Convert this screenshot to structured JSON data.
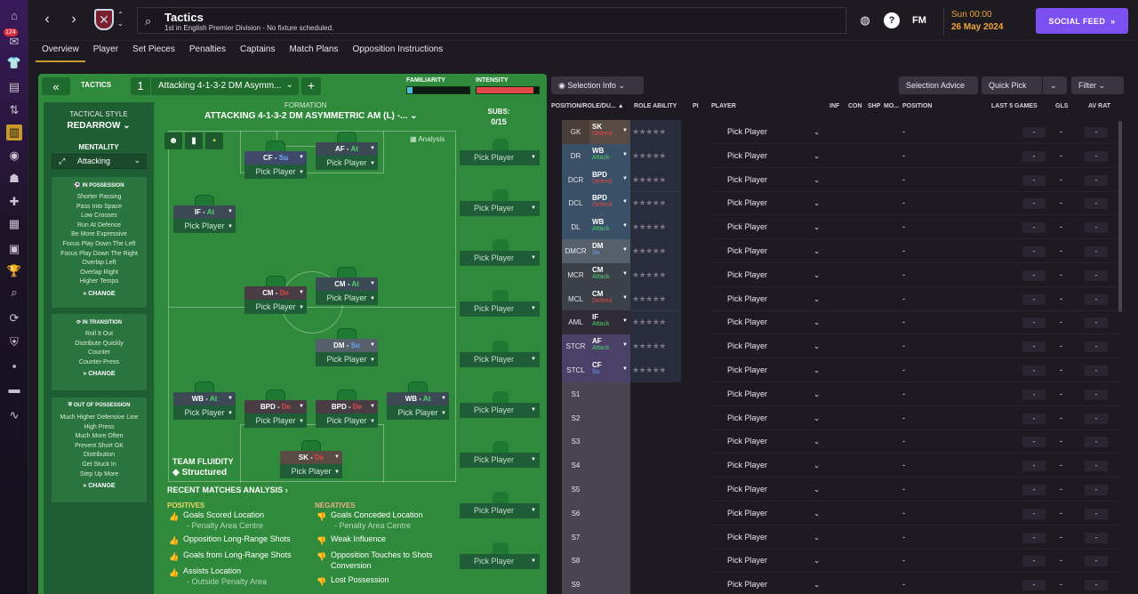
{
  "sidebar": {
    "badge": "124",
    "icons": [
      "home-icon",
      "inbox-icon",
      "squad-icon",
      "document-icon",
      "transfer-icon",
      "tactics-icon",
      "data-icon",
      "staff-icon",
      "medical-icon",
      "schedule-icon",
      "competitions-icon",
      "scouting-icon",
      "swap-icon",
      "club-vision-icon",
      "finance-icon",
      "team-report-icon",
      "news-icon"
    ]
  },
  "header": {
    "title": "Tactics",
    "subtitle": "1st in English Premier Division - No fixture scheduled.",
    "date_time": "Sun 00:00",
    "date_day": "26 May 2024",
    "fm_label": "FM",
    "social_feed": "SOCIAL FEED"
  },
  "tabs": [
    "Overview",
    "Player",
    "Set Pieces",
    "Penalties",
    "Captains",
    "Match Plans",
    "Opposition Instructions"
  ],
  "tactics": {
    "label": "TACTICS",
    "slot_number": "1",
    "selected_tactic": "Attacking 4-1-3-2 DM Asymm...",
    "familiarity_label": "FAMILIARITY",
    "intensity_label": "INTENSITY",
    "familiarity_level": 0.08,
    "intensity_level": 0.92,
    "formation_label": "FORMATION",
    "formation_name": "ATTACKING 4-1-3-2 DM ASYMMETRIC AM (L) -...",
    "analysis_label": "Analysis",
    "subs_label": "SUBS:",
    "subs_count": "0/15",
    "fluidity_label": "TEAM FLUIDITY",
    "fluidity_value": "Structured"
  },
  "style": {
    "title": "TACTICAL STYLE",
    "value": "REDARROW",
    "mentality_label": "MENTALITY",
    "mentality_value": "Attacking",
    "in_possession": {
      "title": "IN POSSESSION",
      "items": [
        "Shorter Passing",
        "Pass Into Space",
        "Low Crosses",
        "Run At Defence",
        "Be More Expressive",
        "Focus Play Down The Left",
        "Focus Play Down The Right",
        "Overlap Left",
        "Overlap Right",
        "Higher Tempo"
      ],
      "change": "CHANGE"
    },
    "in_transition": {
      "title": "IN TRANSITION",
      "items": [
        "Roll It Out",
        "Distribute Quickly",
        "Counter",
        "Counter-Press"
      ],
      "change": "CHANGE"
    },
    "out_of_possession": {
      "title": "OUT OF POSSESSION",
      "items": [
        "Much Higher Defensive Line",
        "High Press",
        "Much More Often",
        "Prevent Short GK",
        "Distribution",
        "Get Stuck In",
        "Step Up More"
      ],
      "change": "CHANGE"
    }
  },
  "pitch_players": [
    {
      "pos": "CF",
      "role": "CF",
      "duty": "Su",
      "pick": "Pick Player"
    },
    {
      "pos": "AF",
      "role": "AF",
      "duty": "At",
      "pick": "Pick Player"
    },
    {
      "pos": "IF",
      "role": "IF",
      "duty": "At",
      "pick": "Pick Player"
    },
    {
      "pos": "CML",
      "role": "CM",
      "duty": "De",
      "pick": "Pick Player"
    },
    {
      "pos": "CMR",
      "role": "CM",
      "duty": "At",
      "pick": "Pick Player"
    },
    {
      "pos": "DM",
      "role": "DM",
      "duty": "Su",
      "pick": "Pick Player"
    },
    {
      "pos": "WBL",
      "role": "WB",
      "duty": "At",
      "pick": "Pick Player"
    },
    {
      "pos": "BPDL",
      "role": "BPD",
      "duty": "De",
      "pick": "Pick Player"
    },
    {
      "pos": "BPDR",
      "role": "BPD",
      "duty": "De",
      "pick": "Pick Player"
    },
    {
      "pos": "WBR",
      "role": "WB",
      "duty": "At",
      "pick": "Pick Player"
    },
    {
      "pos": "GK",
      "role": "SK",
      "duty": "De",
      "pick": "Pick Player"
    }
  ],
  "subs_pick": "Pick Player",
  "recent": {
    "title": "RECENT MATCHES ANALYSIS",
    "positives_label": "POSITIVES",
    "negatives_label": "NEGATIVES",
    "positives": [
      {
        "text": "Goals Scored Location",
        "sub": "- Penalty Area Centre"
      },
      {
        "text": "Opposition Long-Range Shots",
        "sub": ""
      },
      {
        "text": "Goals from Long-Range Shots",
        "sub": ""
      },
      {
        "text": "Assists Location",
        "sub": "- Outside Penalty Area"
      }
    ],
    "negatives": [
      {
        "text": "Goals Conceded Location",
        "sub": "- Penalty Area Centre"
      },
      {
        "text": "Weak Influence",
        "sub": ""
      },
      {
        "text": "Opposition Touches to Shots",
        "sub": "Conversion"
      },
      {
        "text": "Lost Possession",
        "sub": ""
      }
    ]
  },
  "right_panel": {
    "selection_info": "Selection Info",
    "selection_advice": "Selection Advice",
    "quick_pick": "Quick Pick",
    "filter": "Filter",
    "columns": [
      "POSITION/ROLE/DU...",
      "ROLE ABILITY",
      "PI",
      "PLAYER",
      "INF",
      "CON",
      "SHP",
      "MO...",
      "POSITION",
      "LAST 5 GAMES",
      "GLS",
      "AV RAT"
    ],
    "rows": [
      {
        "pos": "GK",
        "role": "SK",
        "duty": "Defend",
        "pick": "Pick Player",
        "position": "-",
        "last5": "-",
        "gls": "-",
        "avrat": "-"
      },
      {
        "pos": "DR",
        "role": "WB",
        "duty": "Attack",
        "pick": "Pick Player",
        "position": "-",
        "last5": "-",
        "gls": "-",
        "avrat": "-"
      },
      {
        "pos": "DCR",
        "role": "BPD",
        "duty": "Defend",
        "pick": "Pick Player",
        "position": "-",
        "last5": "-",
        "gls": "-",
        "avrat": "-"
      },
      {
        "pos": "DCL",
        "role": "BPD",
        "duty": "Defend",
        "pick": "Pick Player",
        "position": "-",
        "last5": "-",
        "gls": "-",
        "avrat": "-"
      },
      {
        "pos": "DL",
        "role": "WB",
        "duty": "Attack",
        "pick": "Pick Player",
        "position": "-",
        "last5": "-",
        "gls": "-",
        "avrat": "-"
      },
      {
        "pos": "DMCR",
        "role": "DM",
        "duty": "Su",
        "pick": "Pick Player",
        "position": "-",
        "last5": "-",
        "gls": "-",
        "avrat": "-"
      },
      {
        "pos": "MCR",
        "role": "CM",
        "duty": "Attack",
        "pick": "Pick Player",
        "position": "-",
        "last5": "-",
        "gls": "-",
        "avrat": "-"
      },
      {
        "pos": "MCL",
        "role": "CM",
        "duty": "Defend",
        "pick": "Pick Player",
        "position": "-",
        "last5": "-",
        "gls": "-",
        "avrat": "-"
      },
      {
        "pos": "AML",
        "role": "IF",
        "duty": "Attack",
        "pick": "Pick Player",
        "position": "-",
        "last5": "-",
        "gls": "-",
        "avrat": "-"
      },
      {
        "pos": "STCR",
        "role": "AF",
        "duty": "Attack",
        "pick": "Pick Player",
        "position": "-",
        "last5": "-",
        "gls": "-",
        "avrat": "-"
      },
      {
        "pos": "STCL",
        "role": "CF",
        "duty": "Su",
        "pick": "Pick Player",
        "position": "-",
        "last5": "-",
        "gls": "-",
        "avrat": "-"
      },
      {
        "pos": "S1",
        "role": "",
        "duty": "",
        "pick": "Pick Player",
        "position": "-",
        "last5": "-",
        "gls": "-",
        "avrat": "-"
      },
      {
        "pos": "S2",
        "role": "",
        "duty": "",
        "pick": "Pick Player",
        "position": "-",
        "last5": "-",
        "gls": "-",
        "avrat": "-"
      },
      {
        "pos": "S3",
        "role": "",
        "duty": "",
        "pick": "Pick Player",
        "position": "-",
        "last5": "-",
        "gls": "-",
        "avrat": "-"
      },
      {
        "pos": "S4",
        "role": "",
        "duty": "",
        "pick": "Pick Player",
        "position": "-",
        "last5": "-",
        "gls": "-",
        "avrat": "-"
      },
      {
        "pos": "S5",
        "role": "",
        "duty": "",
        "pick": "Pick Player",
        "position": "-",
        "last5": "-",
        "gls": "-",
        "avrat": "-"
      },
      {
        "pos": "S6",
        "role": "",
        "duty": "",
        "pick": "Pick Player",
        "position": "-",
        "last5": "-",
        "gls": "-",
        "avrat": "-"
      },
      {
        "pos": "S7",
        "role": "",
        "duty": "",
        "pick": "Pick Player",
        "position": "-",
        "last5": "-",
        "gls": "-",
        "avrat": "-"
      },
      {
        "pos": "S8",
        "role": "",
        "duty": "",
        "pick": "Pick Player",
        "position": "-",
        "last5": "-",
        "gls": "-",
        "avrat": "-"
      },
      {
        "pos": "S9",
        "role": "",
        "duty": "",
        "pick": "Pick Player",
        "position": "-",
        "last5": "-",
        "gls": "-",
        "avrat": "-"
      }
    ]
  },
  "colors": {
    "accent": "#c79a2a",
    "social": "#7c4ff0",
    "pitch": "#2f8a3b",
    "attack": "#4fd16a",
    "defend": "#e04848",
    "support": "#6aa8ff"
  }
}
